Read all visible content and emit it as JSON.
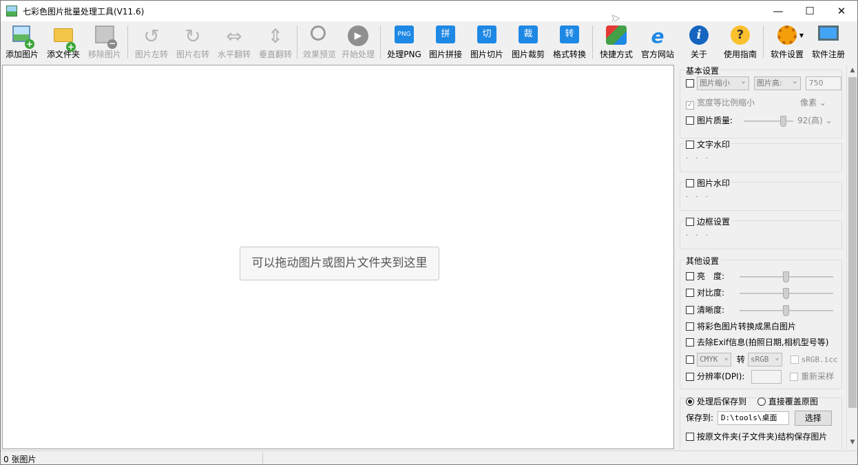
{
  "window": {
    "title": "七彩色图片批量处理工具(V11.6)",
    "controls": {
      "minimize": "—",
      "maximize": "☐",
      "close": "✕"
    }
  },
  "toolbar": {
    "add_image": "添加图片",
    "add_folder": "添文件夹",
    "remove_image": "移除图片",
    "rotate_left": "图片左转",
    "rotate_right": "图片右转",
    "flip_horizontal": "水平翻转",
    "flip_vertical": "垂直翻转",
    "preview": "效果预览",
    "start": "开始处理",
    "process_png": "处理PNG",
    "png_badge": "PNG",
    "stitch": "图片拼接",
    "stitch_badge": "拼",
    "slice": "图片切片",
    "slice_badge": "切",
    "crop": "图片裁剪",
    "crop_badge": "裁",
    "convert": "格式转换",
    "convert_badge": "转",
    "shortcut": "快捷方式",
    "website": "官方网站",
    "about": "关于",
    "guide": "使用指南",
    "settings": "软件设置",
    "register": "软件注册"
  },
  "drop_area": {
    "hint": "可以拖动图片或图片文件夹到这里"
  },
  "panel": {
    "basic": {
      "title": "基本设置",
      "resize_mode": "图片缩小",
      "dimension": "图片高:",
      "size_value": "750",
      "keep_ratio": "宽度等比例缩小",
      "unit": "像素",
      "quality_label": "图片质量:",
      "quality_value": "92(高)"
    },
    "text_watermark": {
      "title": "文字水印",
      "dots": "· · ·"
    },
    "image_watermark": {
      "title": "图片水印",
      "dots": "· · ·"
    },
    "border": {
      "title": "边框设置",
      "dots": "· · ·"
    },
    "other": {
      "title": "其他设置",
      "brightness": "亮　度:",
      "contrast": "对比度:",
      "sharpness": "清晰度:",
      "grayscale": "将彩色图片转换成黑白图片",
      "remove_exif": "去除Exif信息(拍照日期,相机型号等)",
      "cmyk": "CMYK",
      "convert_to": "转",
      "srgb": "sRGB",
      "icc": "sRGB.icc",
      "dpi": "分辨率(DPI):",
      "resample": "重新采样"
    },
    "output": {
      "save_after": "处理后保存到",
      "overwrite": "直接覆盖原图",
      "save_to_label": "保存到:",
      "save_path": "D:\\tools\\桌面",
      "choose": "选择",
      "keep_structure": "按原文件夹(子文件夹)结构保存图片"
    }
  },
  "status": {
    "count": "0 张图片"
  }
}
